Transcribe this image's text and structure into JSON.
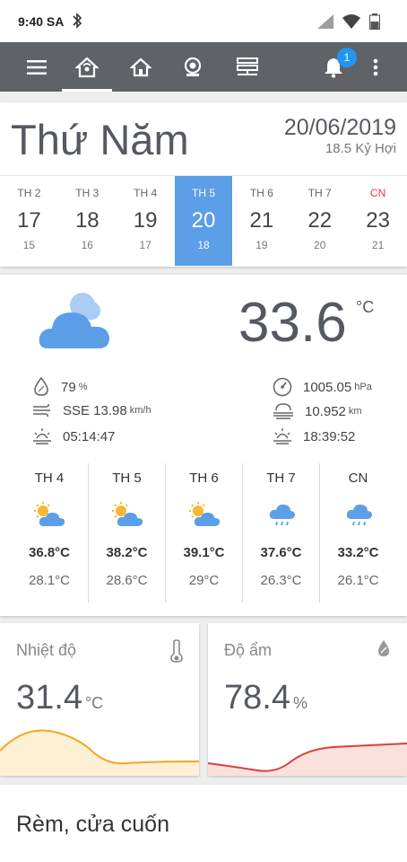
{
  "status": {
    "time": "9:40 SA"
  },
  "toolbar": {
    "notification_count": "1"
  },
  "day_header": {
    "day_name": "Thứ Năm",
    "date": "20/06/2019",
    "lunar": "18.5 Kỷ Hợi"
  },
  "week": [
    {
      "dow": "TH 2",
      "day": "17",
      "lunar": "15"
    },
    {
      "dow": "TH 3",
      "day": "18",
      "lunar": "16"
    },
    {
      "dow": "TH 4",
      "day": "19",
      "lunar": "17"
    },
    {
      "dow": "TH 5",
      "day": "20",
      "lunar": "18"
    },
    {
      "dow": "TH 6",
      "day": "21",
      "lunar": "19"
    },
    {
      "dow": "TH 7",
      "day": "22",
      "lunar": "20"
    },
    {
      "dow": "CN",
      "day": "23",
      "lunar": "21"
    }
  ],
  "weather": {
    "temperature": "33.6",
    "temperature_unit": "°C",
    "humidity": "79",
    "humidity_unit": "%",
    "wind": "SSE 13.98",
    "wind_unit": "km/h",
    "sunrise": "05:14:47",
    "pressure": "1005.05",
    "pressure_unit": "hPa",
    "visibility": "10.952",
    "visibility_unit": "km",
    "sunset": "18:39:52"
  },
  "forecast": [
    {
      "day": "TH 4",
      "icon": "sun-cloud-icon",
      "high": "36.8°C",
      "low": "28.1°C"
    },
    {
      "day": "TH 5",
      "icon": "sun-cloud-icon",
      "high": "38.2°C",
      "low": "28.6°C"
    },
    {
      "day": "TH 6",
      "icon": "sun-cloud-icon",
      "high": "39.1°C",
      "low": "29°C"
    },
    {
      "day": "TH 7",
      "icon": "rain-cloud-icon",
      "high": "37.6°C",
      "low": "26.3°C"
    },
    {
      "day": "CN",
      "icon": "rain-cloud-icon",
      "high": "33.2°C",
      "low": "26.1°C"
    }
  ],
  "sensors": {
    "temperature": {
      "title": "Nhiệt độ",
      "value": "31.4",
      "unit": "°C",
      "color": "#f5a623"
    },
    "humidity": {
      "title": "Độ ẩm",
      "value": "78.4",
      "unit": "%",
      "color": "#d9413a"
    }
  },
  "curtain": {
    "title": "Rèm, cửa cuốn"
  },
  "colors": {
    "toolbar": "#5f6368",
    "accent": "#5c9ee7",
    "badge": "#2196f3",
    "sunday": "#e53935"
  }
}
